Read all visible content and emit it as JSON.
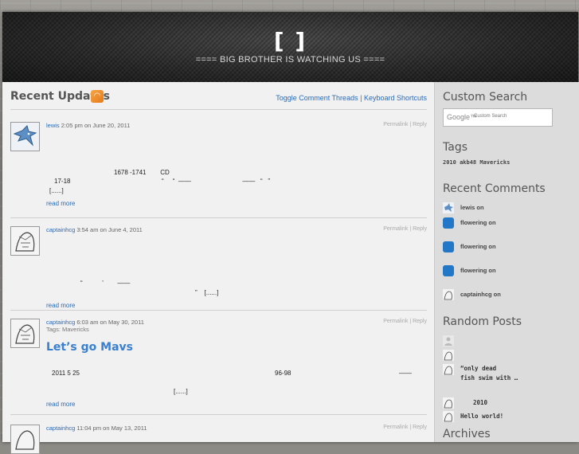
{
  "header": {
    "title": "[          ]",
    "description": "==== BIG BROTHER IS WATCHING US ===="
  },
  "main": {
    "heading": "Recent Updates",
    "links": [
      "Toggle Comment Threads",
      "Keyboard Shortcuts"
    ],
    "separator": "|"
  },
  "posts": [
    {
      "author": "lewis",
      "time": "2:05 pm on June 20, 2011",
      "permalink": "Permalink",
      "reply": "Reply",
      "lines": [
        "1678 -1741        CD",
        "17-18",
        "“     “  ——                             ——   “   ”",
        "[......]"
      ],
      "readmore": "read more"
    },
    {
      "author": "captainhcg",
      "time": "3:54 am on June 4, 2011",
      "permalink": "Permalink",
      "reply": "Reply",
      "lines": [
        "“           ’        ——",
        "”    [......]"
      ],
      "readmore": "read more"
    },
    {
      "author": "captainhcg",
      "time": "6:03 am on May 30, 2011",
      "tags": "Tags: Mavericks",
      "title": "Let’s go Mavs",
      "permalink": "Permalink",
      "reply": "Reply",
      "lines": [
        "2011 5 25",
        "96-98",
        "——",
        "[......]"
      ],
      "readmore": "read more"
    },
    {
      "author": "captainhcg",
      "time": "11:04 pm on May 13, 2011",
      "permalink": "Permalink",
      "reply": "Reply"
    }
  ],
  "sidebar": {
    "search_title": "Custom Search",
    "search_logo": "Google™",
    "search_placeholder": "Custom Search",
    "tags_title": "Tags",
    "tags": "2010  akb48  Mavericks",
    "recent_comments_title": "Recent Comments",
    "recent_comments": [
      "lewis on",
      "flowering on",
      "flowering on",
      "flowering on",
      "captainhcg on"
    ],
    "random_posts_title": "Random Posts",
    "random_posts": [
      "",
      "“only dead\nfish swim with …",
      "2010",
      "Hello world!"
    ],
    "archives_title": "Archives"
  },
  "colors": {
    "link": "#2b6bb7",
    "title_blue": "#3a7fd0",
    "rss": "#f39232"
  }
}
